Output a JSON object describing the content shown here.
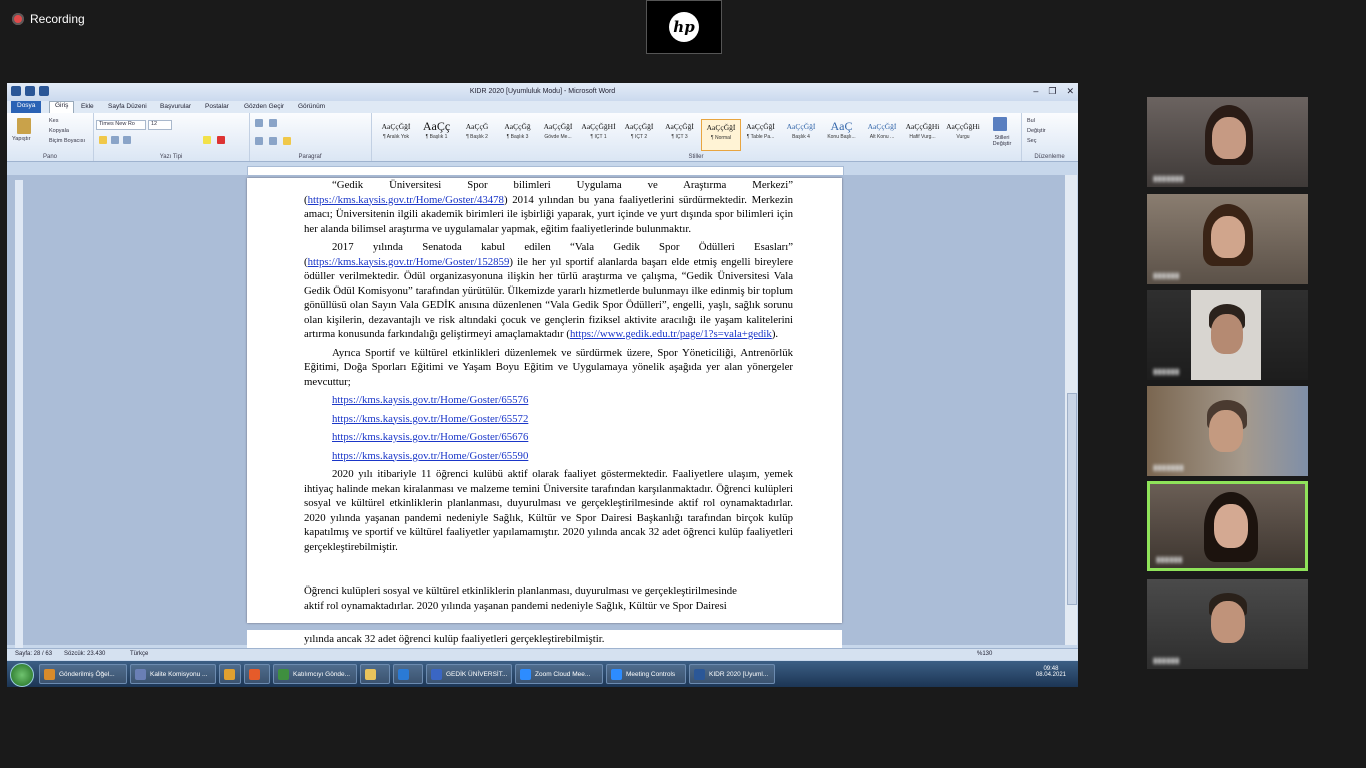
{
  "zoom": {
    "recording_label": "Recording",
    "hp_logo": "hp"
  },
  "word": {
    "title": "KIDR 2020 [Uyumluluk Modu] - Microsoft Word",
    "tabs": [
      "Dosya",
      "Giriş",
      "Ekle",
      "Sayfa Düzeni",
      "Başvurular",
      "Postalar",
      "Gözden Geçir",
      "Görünüm"
    ],
    "ribbon": {
      "pano": {
        "label": "Pano",
        "paste": "Yapıştır",
        "cut": "Kes",
        "copy": "Kopyala",
        "format_painter": "Biçim Boyacısı"
      },
      "yazi_tipi": {
        "label": "Yazı Tipi",
        "font": "Times New Ro",
        "size": "12"
      },
      "paragraf": {
        "label": "Paragraf"
      },
      "stiller": {
        "label": "Stiller",
        "change_styles": "Stilleri Değiştir",
        "items": [
          {
            "preview": "AaÇçĞğİ",
            "name": "¶ Aralık Yok"
          },
          {
            "preview": "AaÇç",
            "name": "¶ Başlık 1"
          },
          {
            "preview": "AaÇçĞ",
            "name": "¶ Başlık 2"
          },
          {
            "preview": "AaÇçĞğ",
            "name": "¶ Başlık 3"
          },
          {
            "preview": "AaÇçĞğİ",
            "name": "Gövde Me..."
          },
          {
            "preview": "AaÇçĞğHİ",
            "name": "¶ İÇT 1"
          },
          {
            "preview": "AaÇçĞğİ",
            "name": "¶ İÇT 2"
          },
          {
            "preview": "AaÇçĞğİ",
            "name": "¶ İÇT 3"
          },
          {
            "preview": "AaÇçĞğİ",
            "name": "¶ Normal"
          },
          {
            "preview": "AaÇçĞğİ",
            "name": "¶ Table Pa..."
          },
          {
            "preview": "AaÇçĞğİ",
            "name": "Başlık 4"
          },
          {
            "preview": "AaÇ",
            "name": "Konu Başlı..."
          },
          {
            "preview": "AaÇçĞğİ",
            "name": "Alt Konu ..."
          },
          {
            "preview": "AaÇçĞğHi",
            "name": "Hafif Vurg..."
          },
          {
            "preview": "AaÇçĞğHi",
            "name": "Vurgu"
          }
        ]
      },
      "duzenleme": {
        "label": "Düzenleme",
        "find": "Bul",
        "replace": "Değiştir",
        "select": "Seç"
      }
    },
    "document": {
      "p1_a": "“Gedik Üniversitesi Spor bilimleri Uygulama ve Araştırma Merkezi” (",
      "p1_link": "https://kms.kaysis.gov.tr/Home/Goster/43478",
      "p1_b": ") 2014 yılından bu yana faaliyetlerini sürdürmektedir. Merkezin amacı; Üniversitenin ilgili akademik birimleri ile işbirliği yaparak, yurt içinde ve yurt dışında spor bilimleri için her alanda bilimsel araştırma ve uygulamalar yapmak, eğitim faaliyetlerinde bulunmaktır.",
      "p2_a": "2017 yılında Senatoda kabul edilen “Vala Gedik Spor Ödülleri Esasları” (",
      "p2_link": "https://kms.kaysis.gov.tr/Home/Goster/152859",
      "p2_b": ") ile her yıl sportif alanlarda başarı elde etmiş engelli bireylere ödüller verilmektedir. Ödül organizasyonuna ilişkin her türlü araştırma ve çalışma, “Gedik Üniversitesi Vala Gedik Ödül Komisyonu” tarafından yürütülür. Ülkemizde yararlı hizmetlerde bulunmayı ilke edinmiş bir toplum gönüllüsü olan Sayın Vala GEDİK anısına düzenlenen “Vala Gedik Spor Ödülleri”, engelli, yaşlı, sağlık sorunu olan kişilerin, dezavantajlı ve risk altındaki çocuk ve gençlerin fiziksel aktivite aracılığı ile yaşam kalitelerini artırma konusunda farkındalığı geliştirmeyi amaçlamaktadır (",
      "p2_link2": "https://www.gedik.edu.tr/page/1?s=vala+gedik",
      "p2_c": ").",
      "p3": "Ayrıca Sportif ve kültürel etkinlikleri düzenlemek ve sürdürmek üzere, Spor Yöneticiliği, Antrenörlük Eğitimi, Doğa Sporları Eğitimi ve Yaşam Boyu Eğitim ve Uygulamaya yönelik aşağıda yer alan yönergeler mevcuttur;",
      "links": [
        "https://kms.kaysis.gov.tr/Home/Goster/65576",
        "https://kms.kaysis.gov.tr/Home/Goster/65572",
        "https://kms.kaysis.gov.tr/Home/Goster/65676",
        "https://kms.kaysis.gov.tr/Home/Goster/65590"
      ],
      "p4": "2020 yılı itibariyle 11 öğrenci kulübü aktif olarak faaliyet göstermektedir. Faaliyetlere ulaşım, yemek ihtiyaç halinde mekan kiralanması ve malzeme temini Üniversite tarafından karşılanmaktadır. Öğrenci kulüpleri sosyal ve kültürel etkinliklerin planlanması, duyurulması ve gerçekleştirilmesinde aktif rol oynamaktadırlar. 2020 yılında yaşanan pandemi nedeniyle Sağlık, Kültür ve Spor Dairesi Başkanlığı tarafından birçok kulüp kapatılmış ve sportif ve kültürel faaliyetler yapılamamıştır. 2020 yılında ancak 32 adet öğrenci kulüp faaliyetleri gerçekleştirebilmiştir.",
      "ghost_1": "Öğrenci kulüpleri sosyal ve kültürel etkinliklerin planlanması, duyurulması ve gerçekleştirilmesinde",
      "ghost_2": "aktif rol oynamaktadırlar. 2020 yılında yaşanan pandemi nedeniyle Sağlık, Kültür ve Spor Dairesi",
      "ghost_3": "yılında ancak 32 adet öğrenci kulüp faaliyetleri gerçekleştirebilmiştir."
    },
    "status": {
      "page": "Sayfa: 28 / 63",
      "words": "Sözcük: 23.430",
      "lang": "Türkçe",
      "zoom": "%130"
    }
  },
  "taskbar": {
    "items": [
      {
        "label": "Gönderilmiş Öğel...",
        "color": "#d98b2b"
      },
      {
        "label": "Kalite Komisyonu ...",
        "color": "#6a7fb5"
      },
      {
        "label": "",
        "color": "#e0a030"
      },
      {
        "label": "",
        "color": "#e55b2a"
      },
      {
        "label": "Katılımcıyı Gönde...",
        "color": "#3f8f3f"
      },
      {
        "label": "",
        "color": "#e8c35c"
      },
      {
        "label": "",
        "color": "#2a7ad5"
      },
      {
        "label": "GEDİK ÜNİVERSİT...",
        "color": "#3a66c4"
      },
      {
        "label": "Zoom Cloud Mee...",
        "color": "#2d8cff"
      },
      {
        "label": "Meeting Controls",
        "color": "#2d8cff"
      },
      {
        "label": "KIDR 2020 [Uyuml...",
        "color": "#2b5797"
      }
    ],
    "time": "09:48",
    "date": "08.04.2021"
  }
}
